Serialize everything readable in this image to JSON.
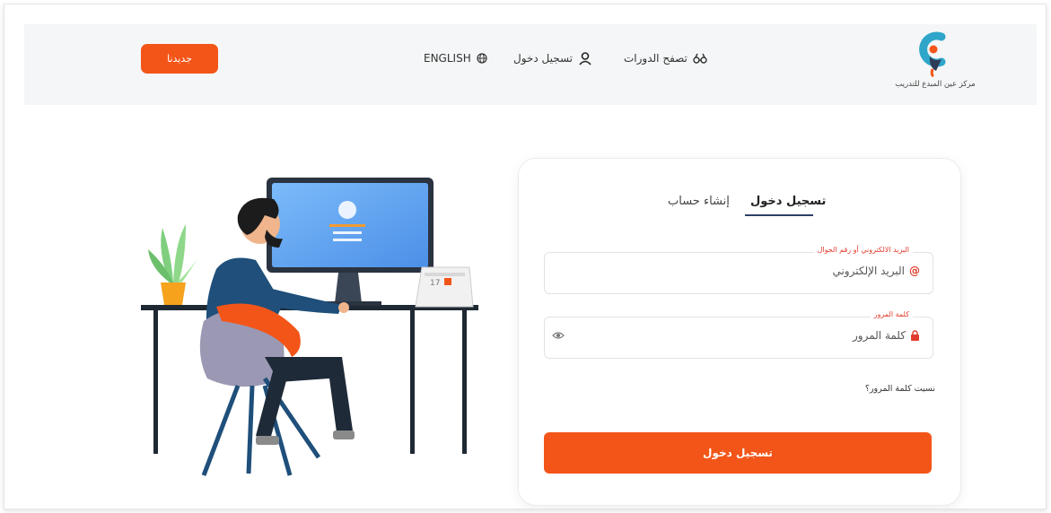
{
  "header": {
    "cta_label": "جديدنا",
    "language_label": "ENGLISH",
    "login_label": "تسجيل دخول",
    "browse_label": "تصفح الدورات",
    "logo_text": "مركز عين المبدع للتدريب"
  },
  "colors": {
    "accent": "#f35519",
    "label_red": "#e23b2b",
    "tab_underline": "#2b4064"
  },
  "icons": {
    "language": "globe-icon",
    "login": "user-icon",
    "browse": "binoculars-icon",
    "email": "at-icon",
    "password": "lock-icon",
    "toggle": "eye-icon"
  },
  "form": {
    "tab_login": "تسجيل دخول",
    "tab_register": "إنشاء حساب",
    "email_label": "البريد الالكتروني أو رقم الجوال",
    "email_placeholder": "البريد الإلكتروني",
    "password_label": "كلمة المرور",
    "password_placeholder": "كلمة المرور",
    "forgot": "نسيت كلمة المرور؟",
    "submit": "تسجيل دخول"
  },
  "calendar": {
    "day": "17"
  }
}
